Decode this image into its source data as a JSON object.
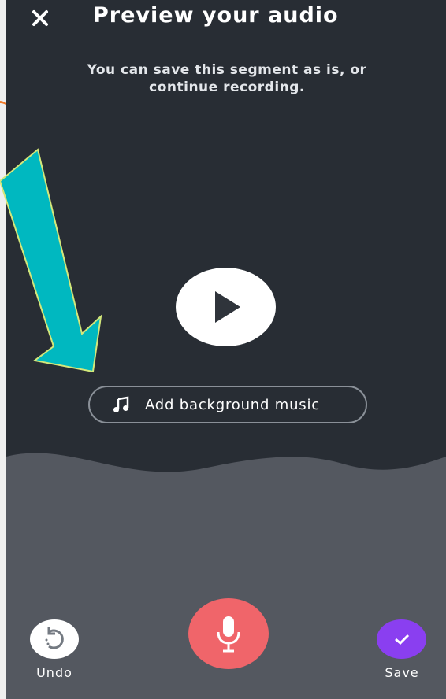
{
  "header": {
    "title": "Preview your audio",
    "close_icon": "close-icon"
  },
  "subtitle": "You can save this segment as is, or continue recording.",
  "player": {
    "play_icon": "play-icon"
  },
  "background_music": {
    "icon": "music-note-icon",
    "label": "Add background music"
  },
  "bottom_bar": {
    "undo": {
      "label": "Undo",
      "icon": "undo-icon"
    },
    "record": {
      "icon": "microphone-icon"
    },
    "save": {
      "label": "Save",
      "icon": "checkmark-icon"
    }
  },
  "colors": {
    "background_top": "#282d34",
    "background_bottom": "#545860",
    "record_button": "#f0656a",
    "save_button": "#8a3ff0",
    "annotation_arrow": "#00b8c0"
  },
  "annotation": {
    "type": "arrow",
    "points_to": "background_music"
  }
}
